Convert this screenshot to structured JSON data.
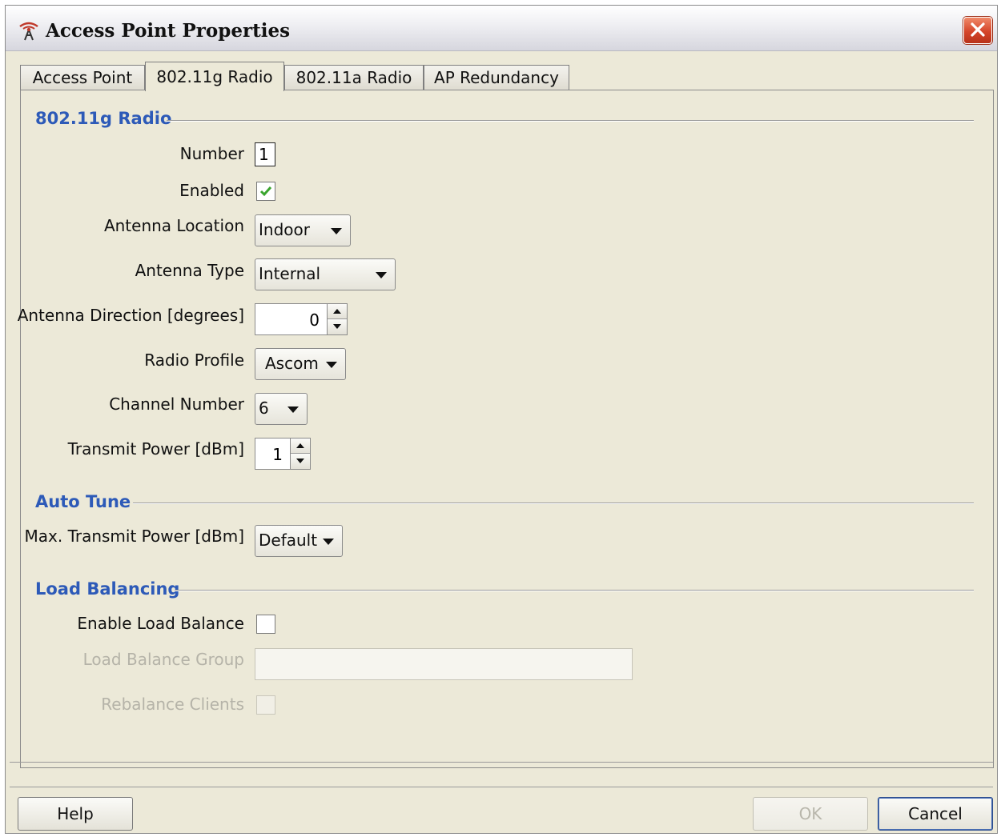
{
  "window": {
    "title": "Access Point Properties"
  },
  "tabs": [
    {
      "label": "Access Point",
      "active": false
    },
    {
      "label": "802.11g Radio",
      "active": true
    },
    {
      "label": "802.11a Radio",
      "active": false
    },
    {
      "label": "AP Redundancy",
      "active": false
    }
  ],
  "radio_section": {
    "title": "802.11g Radio",
    "number": {
      "label": "Number",
      "value": "1"
    },
    "enabled": {
      "label": "Enabled",
      "checked": true
    },
    "antenna_location": {
      "label": "Antenna Location",
      "value": "Indoor"
    },
    "antenna_type": {
      "label": "Antenna Type",
      "value": "Internal"
    },
    "antenna_direction": {
      "label": "Antenna Direction [degrees]",
      "value": "0"
    },
    "radio_profile": {
      "label": "Radio Profile",
      "value": "Ascom"
    },
    "channel_number": {
      "label": "Channel Number",
      "value": "6"
    },
    "transmit_power": {
      "label": "Transmit Power [dBm]",
      "value": "1"
    }
  },
  "auto_tune": {
    "title": "Auto Tune",
    "max_transmit_power": {
      "label": "Max. Transmit Power [dBm]",
      "value": "Default"
    }
  },
  "load_balancing": {
    "title": "Load Balancing",
    "enable": {
      "label": "Enable Load Balance",
      "checked": false
    },
    "group": {
      "label": "Load Balance Group",
      "value": ""
    },
    "rebalance": {
      "label": "Rebalance Clients",
      "checked": false
    }
  },
  "buttons": {
    "help": "Help",
    "ok": "OK",
    "cancel": "Cancel"
  },
  "colors": {
    "section_title": "#2d5ab8",
    "check": "#3aa52e",
    "close": "#d5452a"
  },
  "icons": {
    "app": "antenna-icon",
    "close": "close-icon",
    "check": "checkmark-icon"
  }
}
